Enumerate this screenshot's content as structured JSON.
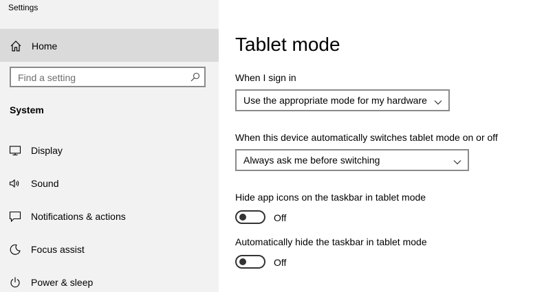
{
  "app": {
    "title": "Settings"
  },
  "sidebar": {
    "home_label": "Home",
    "search_placeholder": "Find a setting",
    "section_heading": "System",
    "items": [
      {
        "label": "Display",
        "icon": "display-icon"
      },
      {
        "label": "Sound",
        "icon": "sound-icon"
      },
      {
        "label": "Notifications & actions",
        "icon": "notifications-icon"
      },
      {
        "label": "Focus assist",
        "icon": "focus-assist-icon"
      },
      {
        "label": "Power & sleep",
        "icon": "power-icon"
      }
    ]
  },
  "main": {
    "title": "Tablet mode",
    "sign_in": {
      "label": "When I sign in",
      "value": "Use the appropriate mode for my hardware"
    },
    "auto_switch": {
      "label": "When this device automatically switches tablet mode on or off",
      "value": "Always ask me before switching"
    },
    "hide_icons": {
      "label": "Hide app icons on the taskbar in tablet mode",
      "state": "Off"
    },
    "hide_taskbar": {
      "label": "Automatically hide the taskbar in tablet mode",
      "state": "Off"
    }
  }
}
